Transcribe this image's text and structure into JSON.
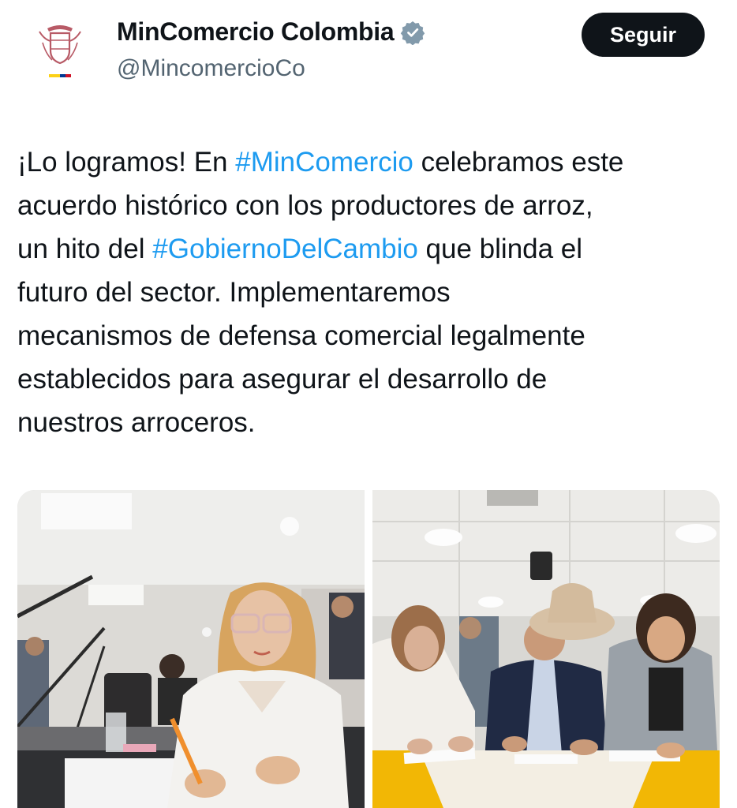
{
  "account": {
    "display_name": "MinComercio Colombia",
    "handle": "@MincomercioCo",
    "verified": true,
    "avatar_icon": "colombia-coat-of-arms-icon",
    "verified_icon": "verified-badge-icon"
  },
  "actions": {
    "follow_label": "Seguir"
  },
  "tweet": {
    "lines": [
      [
        {
          "text": "¡Lo logramos! En "
        },
        {
          "text": "#MinComercio",
          "hashtag": true
        },
        {
          "text": " celebramos este"
        }
      ],
      [
        {
          "text": "acuerdo histórico con los productores de arroz,"
        }
      ],
      [
        {
          "text": "un hito del "
        },
        {
          "text": "#GobiernoDelCambio",
          "hashtag": true
        },
        {
          "text": " que blinda el"
        }
      ],
      [
        {
          "text": "futuro del sector. Implementaremos"
        }
      ],
      [
        {
          "text": "mecanismos de defensa comercial legalmente"
        }
      ],
      [
        {
          "text": "establecidos para asegurar el desarrollo de"
        }
      ],
      [
        {
          "text": "nuestros arroceros."
        }
      ]
    ]
  },
  "media": {
    "photos": [
      {
        "name": "photo-woman-signing-document"
      },
      {
        "name": "photo-group-signing-agreement"
      }
    ]
  },
  "colors": {
    "text": "#0f1419",
    "secondary_text": "#536471",
    "hashtag": "#1d9bf0",
    "button_bg": "#0f1419",
    "button_text": "#ffffff",
    "verified_badge": "#829aab",
    "flag_yellow": "#fcd116",
    "flag_blue": "#003893",
    "flag_red": "#ce1126"
  }
}
